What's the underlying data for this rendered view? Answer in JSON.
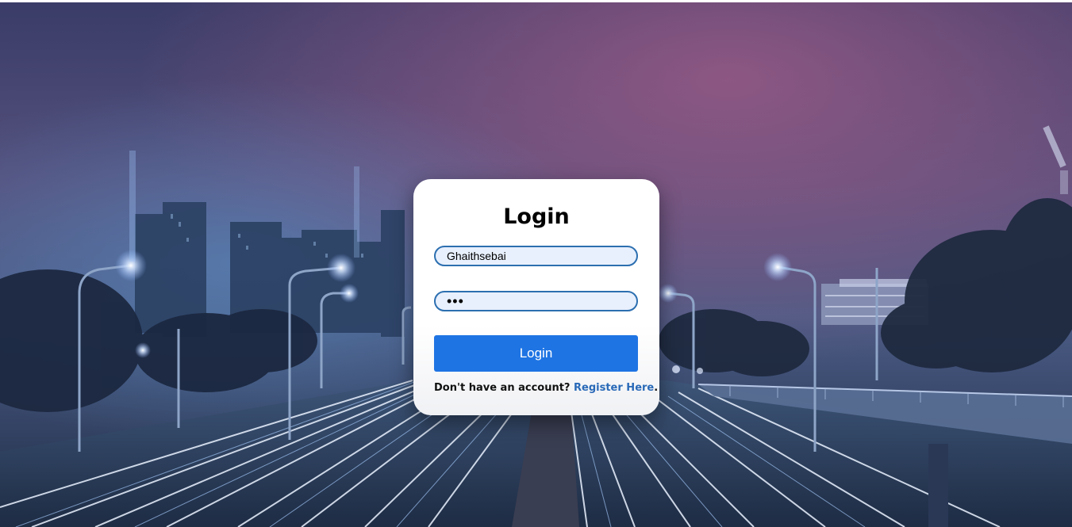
{
  "login_card": {
    "title": "Login",
    "username_value": "Ghaithsebai",
    "password_value": "•••",
    "submit_label": "Login",
    "register_prompt": "Don't have an account?",
    "register_link_label": "Register Here",
    "register_suffix": "."
  },
  "colors": {
    "accent": "#1e74e3",
    "link": "#2a6ab8",
    "field_border": "#2c6fb0",
    "field_bg": "#e8f0fd",
    "card_bg": "#ffffff"
  },
  "background": {
    "scene": "night-city-highway"
  }
}
